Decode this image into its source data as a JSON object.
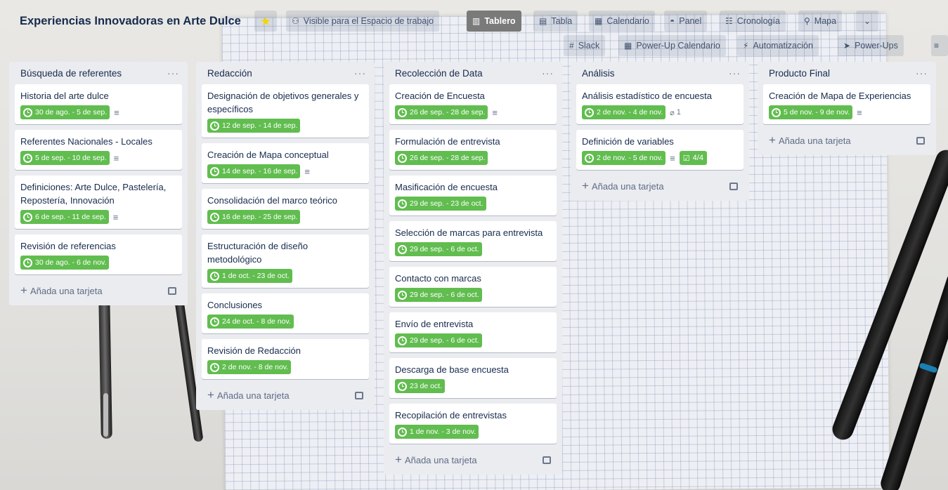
{
  "board": {
    "title": "Experiencias Innovadoras en Arte Dulce",
    "visibility": "Visible para el Espacio de trabajo",
    "views": [
      "Tablero",
      "Tabla",
      "Calendario",
      "Panel",
      "Cronología",
      "Mapa"
    ],
    "active_view": "Tablero",
    "powerups": [
      "Slack",
      "Power-Up Calendario",
      "Automatización",
      "Power-Ups"
    ]
  },
  "lists": [
    {
      "title": "Búsqueda de referentes",
      "cards": [
        {
          "title": "Historia del arte dulce",
          "due": "30 de ago. - 5 de sep.",
          "desc": true
        },
        {
          "title": "Referentes Nacionales - Locales",
          "due": "5 de sep. - 10 de sep.",
          "desc": true
        },
        {
          "title": "Definiciones: Arte Dulce, Pastelería, Repostería, Innovación",
          "due": "6 de sep. - 11 de sep.",
          "desc": true
        },
        {
          "title": "Revisión de referencias",
          "due": "30 de ago. - 6 de nov.",
          "desc": false
        }
      ]
    },
    {
      "title": "Redacción",
      "cards": [
        {
          "title": "Designación de objetivos generales y específicos",
          "due": "12 de sep. - 14 de sep.",
          "desc": false
        },
        {
          "title": "Creación de Mapa conceptual",
          "due": "14 de sep. - 16 de sep.",
          "desc": true
        },
        {
          "title": "Consolidación del marco teórico",
          "due": "16 de sep. - 25 de sep.",
          "desc": false
        },
        {
          "title": "Estructuración de diseño metodológico",
          "due": "1 de oct. - 23 de oct.",
          "desc": false
        },
        {
          "title": "Conclusiones",
          "due": "24 de oct. - 8 de nov.",
          "desc": false
        },
        {
          "title": "Revisión de Redacción",
          "due": "2 de nov. - 8 de nov.",
          "desc": false
        }
      ]
    },
    {
      "title": "Recolección de Data",
      "cards": [
        {
          "title": "Creación de Encuesta",
          "due": "26 de sep. - 28 de sep.",
          "desc": true
        },
        {
          "title": "Formulación de entrevista",
          "due": "26 de sep. - 28 de sep.",
          "desc": false
        },
        {
          "title": "Masificación de encuesta",
          "due": "29 de sep. - 23 de oct.",
          "desc": false
        },
        {
          "title": "Selección de marcas para entrevista",
          "due": "29 de sep. - 6 de oct.",
          "desc": false
        },
        {
          "title": "Contacto con marcas",
          "due": "29 de sep. - 6 de oct.",
          "desc": false
        },
        {
          "title": "Envío de entrevista",
          "due": "29 de sep. - 6 de oct.",
          "desc": false
        },
        {
          "title": "Descarga de base encuesta",
          "due": "23 de oct.",
          "desc": false
        },
        {
          "title": "Recopilación de entrevistas",
          "due": "1 de nov. - 3 de nov.",
          "desc": false
        }
      ]
    },
    {
      "title": "Análisis",
      "cards": [
        {
          "title": "Análisis estadístico de encuesta",
          "due": "2 de nov. - 4 de nov.",
          "desc": false,
          "attachments": "1"
        },
        {
          "title": "Definición de variables",
          "due": "2 de nov. - 5 de nov.",
          "desc": true,
          "checklist": "4/4"
        }
      ]
    },
    {
      "title": "Producto Final",
      "cards": [
        {
          "title": "Creación de Mapa de Experiencias",
          "due": "5 de nov. - 9 de nov.",
          "desc": true
        }
      ]
    }
  ],
  "add_card_label": "Añada una tarjeta",
  "list_menu_label": "···",
  "icons": {
    "star": "star-icon",
    "visibility": "people-icon",
    "due": "clock-icon",
    "description": "description-icon",
    "attachment": "paperclip-icon",
    "checklist": "checklist-icon",
    "template": "card-template-icon"
  },
  "colors": {
    "due_badge": "#61bd4f",
    "active_view": "#7a7a7a",
    "star": "#f2d600",
    "list_bg": "#ebecf0"
  }
}
